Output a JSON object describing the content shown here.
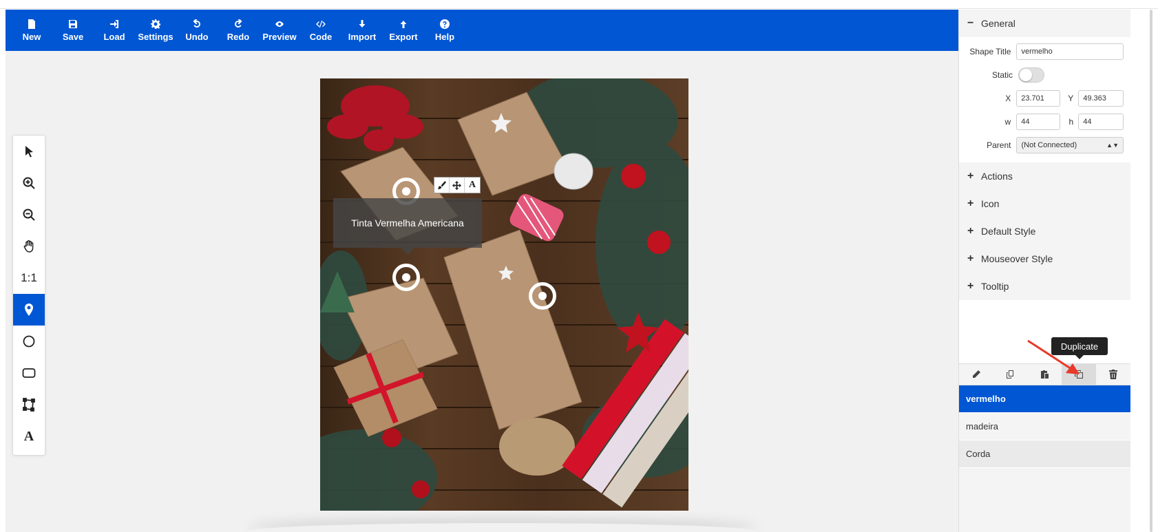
{
  "toolbar": {
    "items": [
      {
        "label": "New",
        "icon": "file-icon"
      },
      {
        "label": "Save",
        "icon": "floppy-icon"
      },
      {
        "label": "Load",
        "icon": "sign-in-icon"
      },
      {
        "label": "Settings",
        "icon": "gear-icon"
      },
      {
        "label": "Undo",
        "icon": "undo-icon"
      },
      {
        "label": "Redo",
        "icon": "redo-icon"
      },
      {
        "label": "Preview",
        "icon": "eye-icon"
      },
      {
        "label": "Code",
        "icon": "code-icon"
      },
      {
        "label": "Import",
        "icon": "arrow-down-icon"
      },
      {
        "label": "Export",
        "icon": "arrow-up-icon"
      },
      {
        "label": "Help",
        "icon": "question-icon"
      }
    ]
  },
  "left_tools": {
    "items": [
      "pointer-icon",
      "zoom-in-icon",
      "zoom-out-icon",
      "hand-icon",
      "actual-size",
      "map-pin-icon",
      "circle-icon",
      "rounded-rect-icon",
      "polygon-icon",
      "text-icon"
    ],
    "ratio_label": "1:1",
    "text_label": "A",
    "active": "map-pin-icon"
  },
  "canvas": {
    "tooltip_text": "Tinta Vermelha Americana",
    "mini_toolbar_text_label": "A"
  },
  "panel": {
    "general": {
      "title": "General",
      "sign": "−",
      "shape_title_label": "Shape Title",
      "shape_title_value": "vermelho",
      "static_label": "Static",
      "static_on": false,
      "x_label": "X",
      "x_value": "23.701",
      "y_label": "Y",
      "y_value": "49.363",
      "w_label": "w",
      "w_value": "44",
      "h_label": "h",
      "h_value": "44",
      "parent_label": "Parent",
      "parent_value": "(Not Connected)"
    },
    "sections": [
      {
        "label": "Actions",
        "sign": "+"
      },
      {
        "label": "Icon",
        "sign": "+"
      },
      {
        "label": "Default Style",
        "sign": "+"
      },
      {
        "label": "Mouseover Style",
        "sign": "+"
      },
      {
        "label": "Tooltip",
        "sign": "+"
      }
    ],
    "shape_actions": [
      "pencil-icon",
      "copy-style-icon",
      "paste-style-icon",
      "duplicate-icon",
      "trash-icon"
    ],
    "duplicate_tooltip": "Duplicate",
    "shapes": [
      {
        "name": "vermelho",
        "selected": true
      },
      {
        "name": "madeira",
        "selected": false
      },
      {
        "name": "Corda",
        "selected": false
      }
    ]
  },
  "colors": {
    "accent": "#0056d3",
    "annotation_arrow": "#e8392a"
  }
}
